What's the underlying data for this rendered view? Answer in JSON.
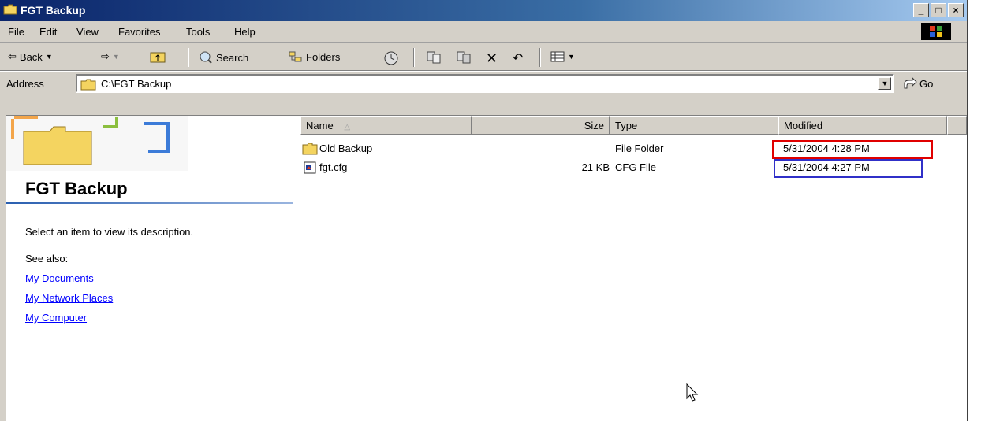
{
  "window": {
    "title": "FGT Backup"
  },
  "title_buttons": {
    "minimize": "_",
    "maximize": "□",
    "close": "×"
  },
  "menu": [
    "File",
    "Edit",
    "View",
    "Favorites",
    "Tools",
    "Help"
  ],
  "toolbar": {
    "back": "Back",
    "search": "Search",
    "folders": "Folders"
  },
  "address": {
    "label": "Address",
    "value": "C:\\FGT Backup",
    "go": "Go"
  },
  "left_pane": {
    "title": "FGT Backup",
    "description": "Select an item to view its description.",
    "see_also": "See also:",
    "links": [
      "My Documents",
      "My Network Places",
      "My Computer"
    ]
  },
  "columns": {
    "name": "Name",
    "size": "Size",
    "type": "Type",
    "modified": "Modified"
  },
  "files": [
    {
      "name": "Old Backup",
      "size": "",
      "type": "File Folder",
      "modified": "5/31/2004 4:28 PM",
      "icon": "folder-icon"
    },
    {
      "name": "fgt.cfg",
      "size": "21 KB",
      "type": "CFG File",
      "modified": "5/31/2004 4:27 PM",
      "icon": "cfg-file-icon"
    }
  ],
  "colors": {
    "title_start": "#0a246a",
    "link": "#0000ff",
    "highlight_red": "#e00000",
    "highlight_blue": "#3030c8"
  }
}
